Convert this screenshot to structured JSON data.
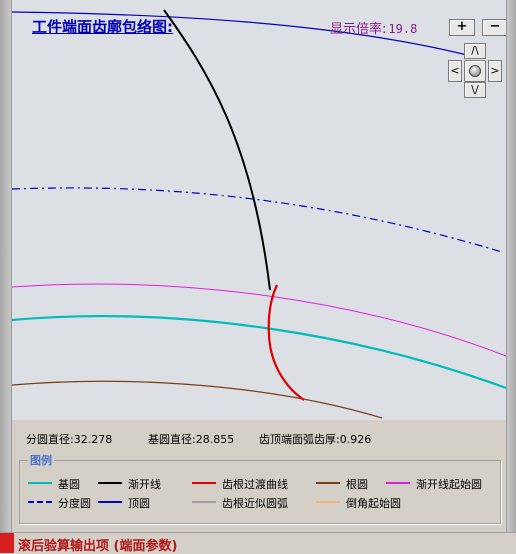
{
  "canvas": {
    "title": "工件端面齿廓包络图:",
    "zoom_label": "显示倍率:",
    "zoom_value": "19.8"
  },
  "controls": {
    "zoom_in": "+",
    "zoom_out": "−",
    "pan_up": "/\\",
    "pan_down": "\\/",
    "pan_left": "<",
    "pan_right": ">"
  },
  "info": {
    "root_diameter": "分圆直径:32.278",
    "base_diameter": "基圆直径:28.855",
    "tip_thickness": "齿顶端面弧齿厚:0.926"
  },
  "legend": {
    "caption": "图例",
    "items": [
      {
        "label": "基圆",
        "color": "#00bcbc",
        "style": "solid"
      },
      {
        "label": "渐开线",
        "color": "#000000",
        "style": "solid"
      },
      {
        "label": "齿根过渡曲线",
        "color": "#e00000",
        "style": "solid"
      },
      {
        "label": "根圆",
        "color": "#7b3f16",
        "style": "solid"
      },
      {
        "label": "渐开线起始圆",
        "color": "#e020e0",
        "style": "solid"
      },
      {
        "label": "分度圆",
        "color": "#0000c0",
        "style": "dashdot"
      },
      {
        "label": "顶圆",
        "color": "#0000c0",
        "style": "solid"
      },
      {
        "label": "齿根近似圆弧",
        "color": "#a0a0a0",
        "style": "solid"
      },
      {
        "label": "倒角起始圆",
        "color": "#f5b080",
        "style": "solid"
      }
    ]
  },
  "section": {
    "title": "滚后验算输出项 (端面参数)"
  }
}
